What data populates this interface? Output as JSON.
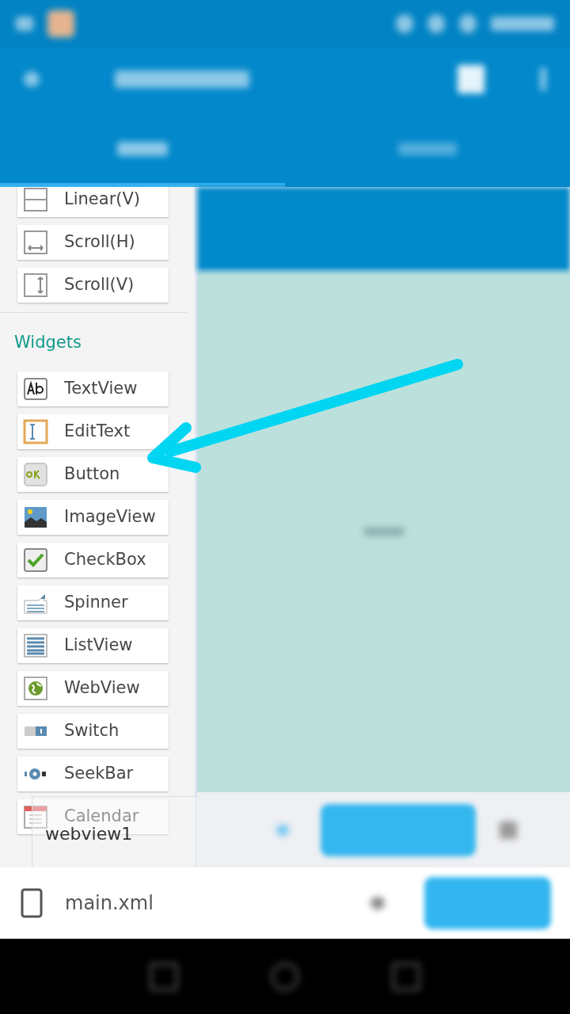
{
  "palette": {
    "sections": [
      {
        "items": [
          {
            "label": "Linear(V)",
            "kind": "linear"
          },
          {
            "label": "Scroll(H)",
            "kind": "scrollh"
          },
          {
            "label": "Scroll(V)",
            "kind": "scrollv"
          }
        ]
      },
      {
        "title": "Widgets",
        "items": [
          {
            "label": "TextView",
            "kind": "textview"
          },
          {
            "label": "EditText",
            "kind": "edittext"
          },
          {
            "label": "Button",
            "kind": "button"
          },
          {
            "label": "ImageView",
            "kind": "imageview"
          },
          {
            "label": "CheckBox",
            "kind": "checkbox"
          },
          {
            "label": "Spinner",
            "kind": "spinner"
          },
          {
            "label": "ListView",
            "kind": "listview"
          },
          {
            "label": "WebView",
            "kind": "webview"
          },
          {
            "label": "Switch",
            "kind": "switch"
          },
          {
            "label": "SeekBar",
            "kind": "seekbar"
          },
          {
            "label": "Calendar",
            "kind": "calendar"
          }
        ]
      }
    ]
  },
  "drag_ghost": {
    "label": "webview1"
  },
  "file": {
    "name": "main.xml"
  }
}
